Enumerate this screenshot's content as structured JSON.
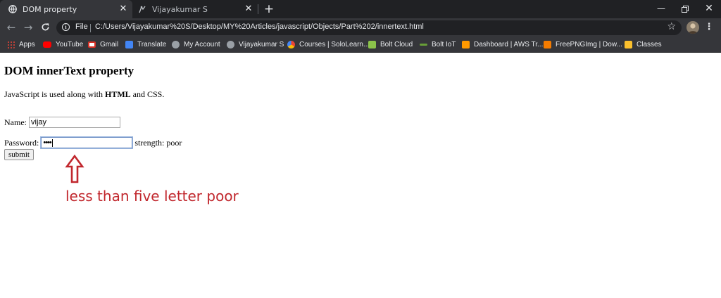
{
  "browser": {
    "tabs": [
      {
        "title": "DOM property",
        "active": true,
        "icon": "globe-icon"
      },
      {
        "title": "Vijayakumar S",
        "active": false,
        "icon": "person-icon"
      }
    ],
    "address": {
      "scheme_label": "File",
      "url": "C:/Users/Vijayakumar%20S/Desktop/MY%20Articles/javascript/Objects/Part%202/innertext.html"
    },
    "bookmarks": [
      {
        "label": "Apps",
        "icon": "apps-grid-icon",
        "color": "#f4b400"
      },
      {
        "label": "YouTube",
        "icon": "youtube-icon",
        "color": "#ff0000"
      },
      {
        "label": "Gmail",
        "icon": "gmail-icon",
        "color": "#d93025"
      },
      {
        "label": "Translate",
        "icon": "translate-icon",
        "color": "#4285f4"
      },
      {
        "label": "My Account",
        "icon": "person-icon",
        "color": "#9aa0a6"
      },
      {
        "label": "Vijayakumar S",
        "icon": "person-icon",
        "color": "#9aa0a6"
      },
      {
        "label": "Courses | SoloLearn...",
        "icon": "sololearn-icon",
        "color": "#149ef2"
      },
      {
        "label": "Bolt Cloud",
        "icon": "bolt-cloud-icon",
        "color": "#8bc34a"
      },
      {
        "label": "Bolt IoT",
        "icon": "bolt-iot-icon",
        "color": "#689f38"
      },
      {
        "label": "Dashboard | AWS Tr...",
        "icon": "aws-icon",
        "color": "#ff9900"
      },
      {
        "label": "FreePNGImg | Dow...",
        "icon": "freepng-icon",
        "color": "#f57c00"
      },
      {
        "label": "Classes",
        "icon": "classroom-icon",
        "color": "#fbc02d"
      }
    ]
  },
  "page": {
    "heading": "DOM innerText property",
    "paragraph": {
      "before": "JavaScript is used along with ",
      "bold": "HTML",
      "after": " and CSS."
    },
    "name_label": "Name:",
    "name_value": "vijay",
    "password_label": "Password:",
    "password_mask": "••••",
    "strength_text": "strength: poor",
    "submit_label": "submit"
  },
  "annotation": {
    "text": "less than five letter poor",
    "color": "#c1272d"
  }
}
